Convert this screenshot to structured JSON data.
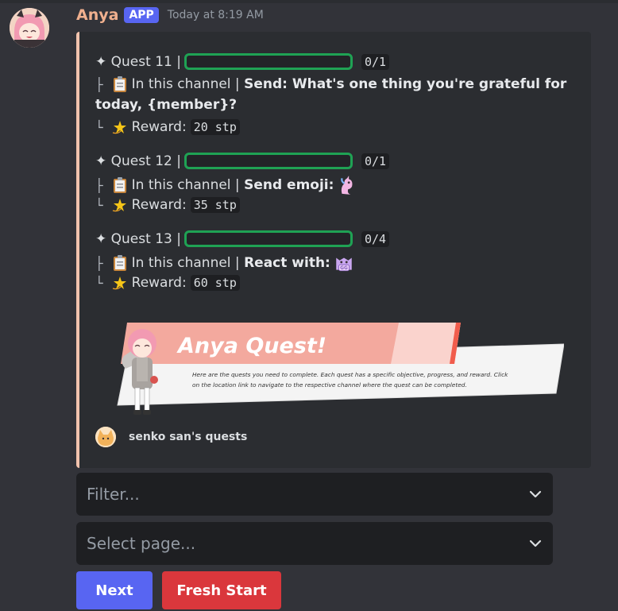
{
  "message": {
    "author": "Anya",
    "badge": "APP",
    "timestamp": "Today at 8:19 AM"
  },
  "quests": [
    {
      "title": "✦ Quest 11 |",
      "progress_text": "0/1",
      "progress_fraction": 0,
      "location_prefix": "In this channel |",
      "task_a": "Send: What's one thing you're grateful for",
      "task_b": "today, {member}?",
      "reward_label": "Reward:",
      "reward": "20 stp"
    },
    {
      "title": "✦ Quest 12 |",
      "progress_text": "0/1",
      "progress_fraction": 0,
      "location_prefix": "In this channel |",
      "task_a": "Send emoji:",
      "reward_label": "Reward:",
      "reward": "35 stp"
    },
    {
      "title": "✦ Quest 13 |",
      "progress_text": "0/4",
      "progress_fraction": 0,
      "location_prefix": "In this channel |",
      "task_a": "React with:",
      "reward_label": "Reward:",
      "reward": "60 stp"
    }
  ],
  "banner": {
    "title": "Anya Quest!",
    "desc_1": "Here are the quests you need to complete. Each quest has a specific objective, progress, and reward. Click",
    "desc_2": "on the location link to navigate to the respective channel where the quest can be completed."
  },
  "footer": {
    "text": "senko san's quests"
  },
  "selects": {
    "filter_placeholder": "Filter...",
    "page_placeholder": "Select page..."
  },
  "buttons": {
    "next": "Next",
    "fresh_start": "Fresh Start"
  },
  "colors": {
    "accent_bar": "#f1c2ad",
    "progress_border": "#1fa254",
    "primary_button": "#5865f2",
    "danger_button": "#da373c",
    "author_name": "#f0b08e"
  }
}
